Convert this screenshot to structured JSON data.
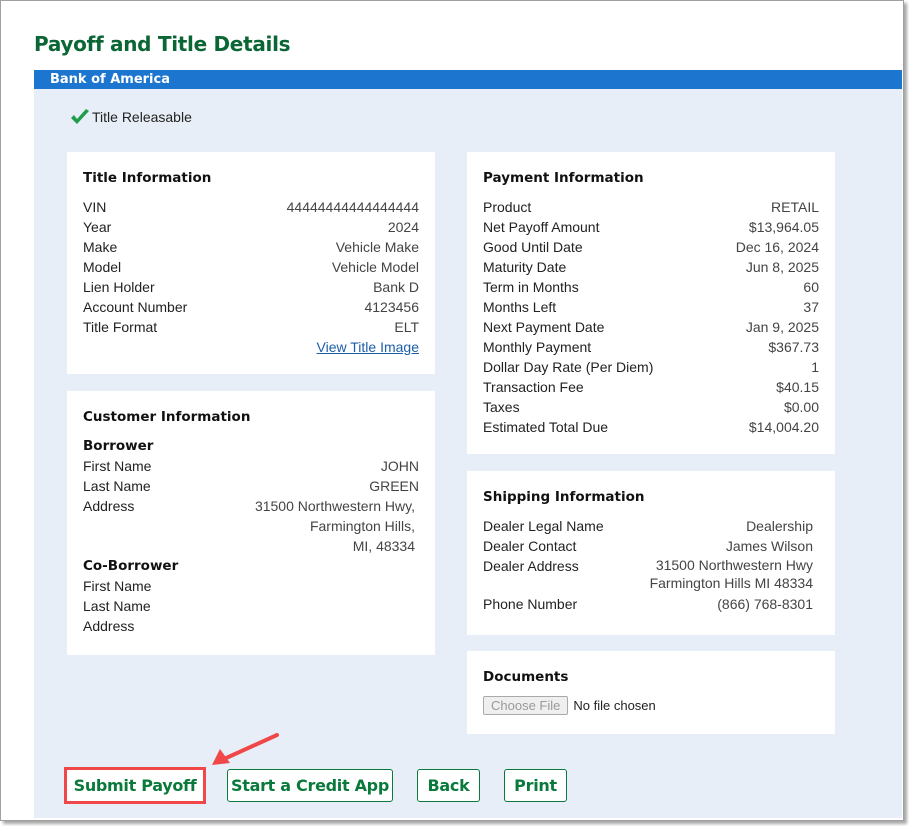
{
  "page": {
    "title": "Payoff and Title Details",
    "lender": "Bank of America",
    "status": {
      "icon": "check-icon",
      "label": "Title Releasable",
      "color": "#1f9e4a"
    }
  },
  "title_info": {
    "heading": "Title Information",
    "rows": [
      {
        "label": "VIN",
        "value": "44444444444444444"
      },
      {
        "label": "Year",
        "value": "2024"
      },
      {
        "label": "Make",
        "value": "Vehicle Make"
      },
      {
        "label": "Model",
        "value": "Vehicle Model"
      },
      {
        "label": "Lien Holder",
        "value": "Bank D"
      },
      {
        "label": "Account Number",
        "value": "4123456"
      },
      {
        "label": "Title Format",
        "value": "ELT"
      }
    ],
    "link": "View Title Image"
  },
  "customer_info": {
    "heading": "Customer Information",
    "borrower": {
      "heading": "Borrower",
      "first_name_label": "First Name",
      "first_name": "JOHN",
      "last_name_label": "Last Name",
      "last_name": "GREEN",
      "address_label": "Address",
      "address_lines": [
        "31500 Northwestern Hwy,",
        "Farmington Hills,",
        "MI, 48334"
      ]
    },
    "co_borrower": {
      "heading": "Co-Borrower",
      "first_name_label": "First Name",
      "first_name": "",
      "last_name_label": "Last Name",
      "last_name": "",
      "address_label": "Address",
      "address": ""
    }
  },
  "payment_info": {
    "heading": "Payment Information",
    "rows": [
      {
        "label": "Product",
        "value": "RETAIL"
      },
      {
        "label": "Net Payoff Amount",
        "value": "$13,964.05"
      },
      {
        "label": "Good Until Date",
        "value": "Dec 16, 2024"
      },
      {
        "label": "Maturity Date",
        "value": "Jun 8, 2025"
      },
      {
        "label": "Term in Months",
        "value": "60"
      },
      {
        "label": "Months Left",
        "value": "37"
      },
      {
        "label": "Next Payment Date",
        "value": "Jan 9, 2025"
      },
      {
        "label": "Monthly Payment",
        "value": "$367.73"
      },
      {
        "label": "Dollar Day Rate (Per Diem)",
        "value": "1"
      },
      {
        "label": "Transaction Fee",
        "value": "$40.15"
      },
      {
        "label": "Taxes",
        "value": "$0.00"
      },
      {
        "label": "Estimated Total Due",
        "value": "$14,004.20"
      }
    ]
  },
  "shipping_info": {
    "heading": "Shipping Information",
    "dealer_legal_name_label": "Dealer Legal Name",
    "dealer_legal_name": "Dealership",
    "dealer_contact_label": "Dealer Contact",
    "dealer_contact": "James Wilson",
    "dealer_address_label": "Dealer Address",
    "dealer_address_lines": [
      "31500 Northwestern Hwy",
      "Farmington Hills MI 48334"
    ],
    "phone_label": "Phone Number",
    "phone": "(866) 768-8301"
  },
  "documents": {
    "heading": "Documents",
    "choose_file_label": "Choose File",
    "file_status": "No file chosen"
  },
  "actions": {
    "submit_payoff": "Submit Payoff",
    "start_credit_app": "Start a Credit App",
    "back": "Back",
    "print": "Print"
  },
  "colors": {
    "title_green": "#0a6634",
    "button_green": "#0a7a3c",
    "band_blue": "#1c75cf",
    "panel_bg": "#e8eef7",
    "highlight_red": "#f04848",
    "link_blue": "#1c5fa8"
  }
}
